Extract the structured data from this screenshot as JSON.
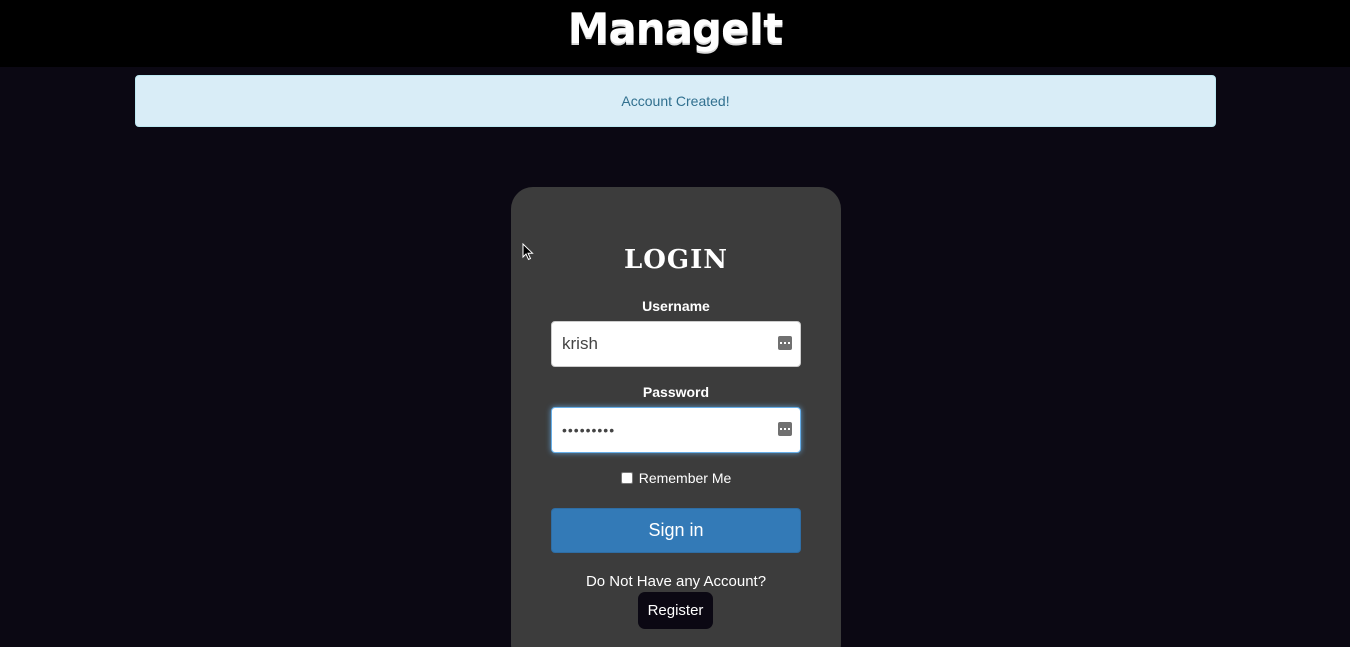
{
  "header": {
    "brand": "ManageIt"
  },
  "alert": {
    "message": "Account Created!"
  },
  "login": {
    "title": "LOGIN",
    "username_label": "Username",
    "username_value": "krish",
    "password_label": "Password",
    "password_value": "•••••••••",
    "remember_label": "Remember Me",
    "remember_checked": false,
    "signin_label": "Sign in",
    "no_account_text": "Do Not Have any Account?",
    "register_label": "Register"
  },
  "colors": {
    "page_bg": "#0b0813",
    "header_bg": "#000000",
    "card_bg": "#3c3c3c",
    "alert_bg": "#d9edf7",
    "alert_text": "#31708f",
    "primary_button": "#337ab7"
  },
  "icons": {
    "field_autofill": "key-autofill-icon",
    "cursor": "mouse-pointer-icon"
  }
}
